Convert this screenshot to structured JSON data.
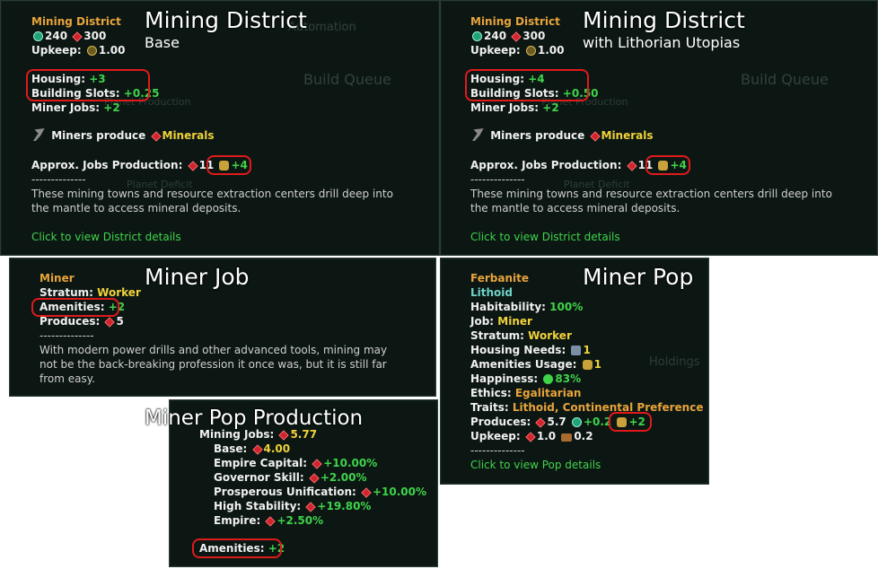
{
  "titles": {
    "district_base": "Mining District",
    "district_base_sub": "Base",
    "district_lith": "Mining District",
    "district_lith_sub": "with Lithorian Utopias",
    "job": "Miner Job",
    "pop": "Miner Pop",
    "production": "Miner Pop Production"
  },
  "background_ui": {
    "automation": "Automation",
    "build_queue": "Build Queue",
    "planet_production": "Planet Production",
    "planet_deficit": "Planet Deficit",
    "holdings": "Holdings"
  },
  "district_base": {
    "name": "Mining District",
    "cost_1": "240",
    "cost_2": "300",
    "upkeep_label": "Upkeep:",
    "upkeep_value": "1.00",
    "housing_label": "Housing:",
    "housing_value": "+3",
    "slots_label": "Building Slots:",
    "slots_value": "+0.25",
    "jobs_label": "Miner Jobs:",
    "jobs_value": "+2",
    "produce_label": "Miners produce",
    "produce_value": "Minerals",
    "approx_label": "Approx. Jobs Production:",
    "approx_value": "11",
    "approx_amen": "+4",
    "divider": "--------------",
    "desc_1": "These mining towns and resource extraction centers drill deep into",
    "desc_2": "the mantle to access mineral deposits.",
    "link": "Click to view District details"
  },
  "district_lith": {
    "name": "Mining District",
    "cost_1": "240",
    "cost_2": "300",
    "upkeep_label": "Upkeep:",
    "upkeep_value": "1.00",
    "housing_label": "Housing:",
    "housing_value": "+4",
    "slots_label": "Building Slots:",
    "slots_value": "+0.50",
    "jobs_label": "Miner Jobs:",
    "jobs_value": "+2",
    "produce_label": "Miners produce",
    "produce_value": "Minerals",
    "approx_label": "Approx. Jobs Production:",
    "approx_value": "11",
    "approx_amen": "+4",
    "divider": "--------------",
    "desc_1": "These mining towns and resource extraction centers drill deep into",
    "desc_2": "the mantle to access mineral deposits.",
    "link": "Click to view District details"
  },
  "job": {
    "name": "Miner",
    "stratum_label": "Stratum:",
    "stratum_value": "Worker",
    "amen_label": "Amenities:",
    "amen_value": "+2",
    "produces_label": "Produces:",
    "produces_value": "5",
    "divider": "--------------",
    "desc_1": "With modern power drills and other advanced tools, mining may",
    "desc_2": "not be the back-breaking profession it once was, but it is still far",
    "desc_3": "from easy."
  },
  "pop": {
    "name": "Ferbanite",
    "species": "Lithoid",
    "hab_label": "Habitability:",
    "hab_value": "100%",
    "job_label": "Job:",
    "job_value": "Miner",
    "stratum_label": "Stratum:",
    "stratum_value": "Worker",
    "housing_label": "Housing Needs:",
    "housing_value": "1",
    "amen_label": "Amenities Usage:",
    "amen_value": "1",
    "happy_label": "Happiness:",
    "happy_value": "83%",
    "ethics_label": "Ethics:",
    "ethics_value": "Egalitarian",
    "traits_label": "Traits:",
    "traits_value_1": "Lithoid",
    "traits_value_2": "Continental Preference",
    "produces_label": "Produces:",
    "produces_value": "5.7",
    "produces_2": "+0.2",
    "produces_amen": "+2",
    "upkeep_label": "Upkeep:",
    "upkeep_value": "1.0",
    "upkeep_2": "0.2",
    "divider": "--------------",
    "link": "Click to view Pop details"
  },
  "production": {
    "jobs_label": "Mining Jobs:",
    "jobs_value": "5.77",
    "base_label": "Base:",
    "base_value": "4.00",
    "capital_label": "Empire Capital:",
    "capital_value": "+10.00%",
    "governor_label": "Governor Skill:",
    "governor_value": "+2.00%",
    "unification_label": "Prosperous Unification:",
    "unification_value": "+10.00%",
    "stability_label": "High Stability:",
    "stability_value": "+19.80%",
    "empire_label": "Empire:",
    "empire_value": "+2.50%",
    "amen_label": "Amenities:",
    "amen_value": "+2"
  },
  "colors": {
    "panel_bg": "#0c1714",
    "highlight": "#e01a1a",
    "accent_orange": "#e8a33b",
    "positive_green": "#3fd34a",
    "resource_yellow": "#f0d23a"
  }
}
